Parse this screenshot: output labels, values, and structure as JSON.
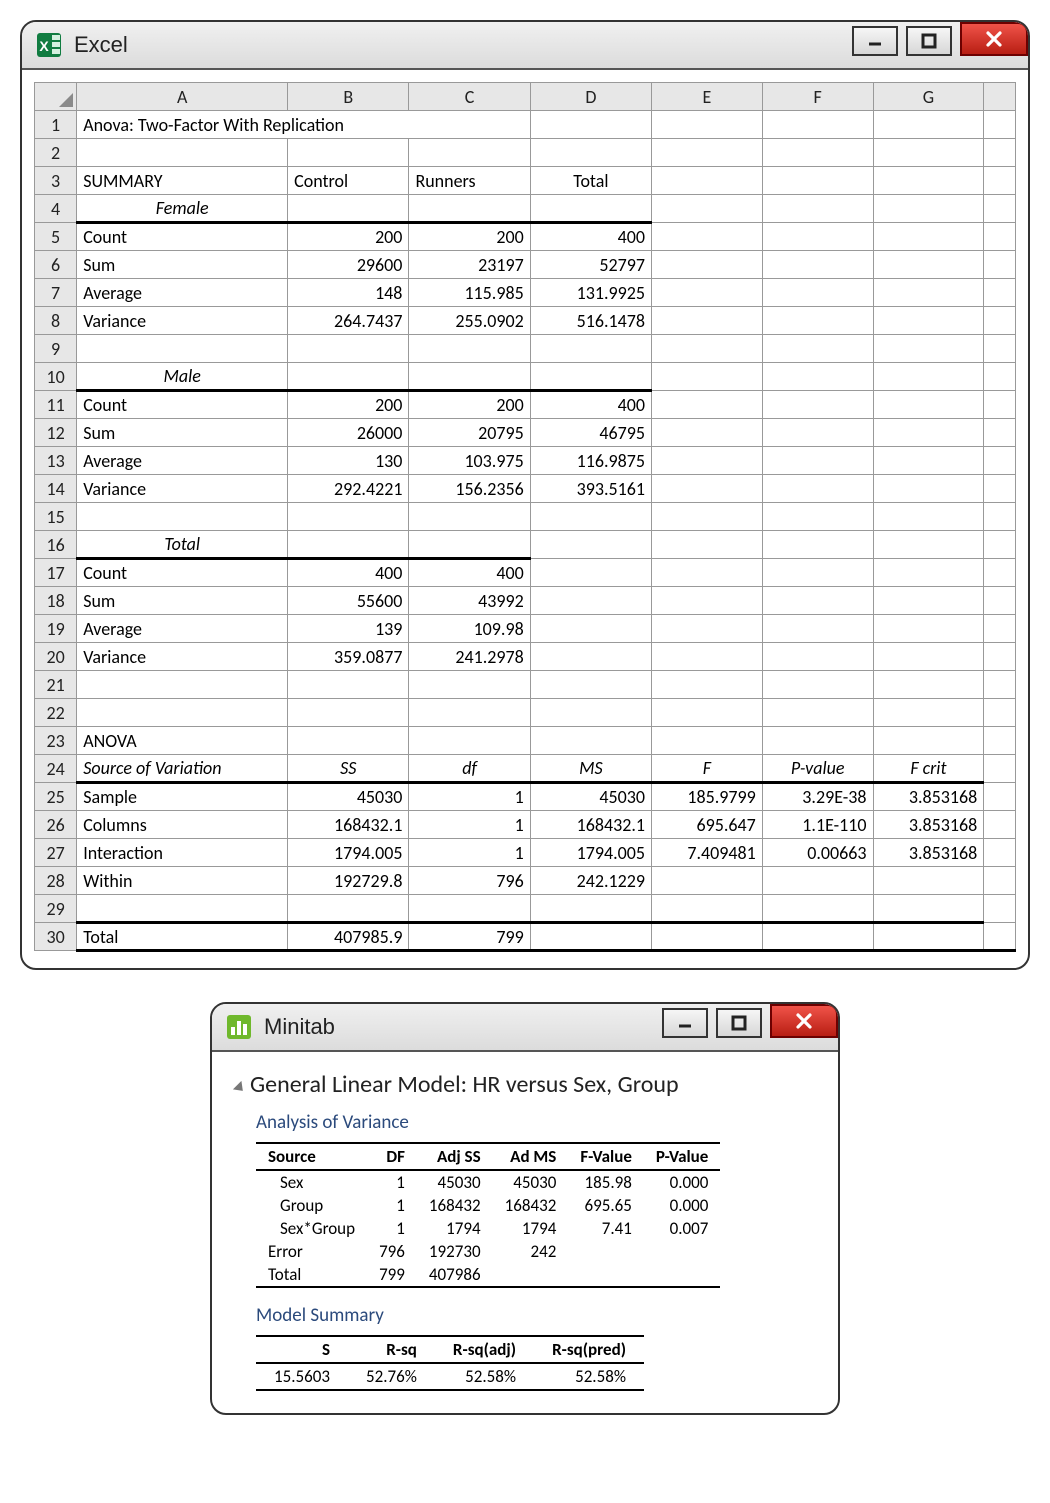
{
  "excel": {
    "app_name": "Excel",
    "columns": [
      "A",
      "B",
      "C",
      "D",
      "E",
      "F",
      "G"
    ],
    "row_numbers": [
      1,
      2,
      3,
      4,
      5,
      6,
      7,
      8,
      9,
      10,
      11,
      12,
      13,
      14,
      15,
      16,
      17,
      18,
      19,
      20,
      21,
      22,
      23,
      24,
      25,
      26,
      27,
      28,
      29,
      30
    ],
    "r1_title": "Anova: Two-Factor With Replication",
    "r3": {
      "A": "SUMMARY",
      "B": "Control",
      "C": "Runners",
      "D": "Total"
    },
    "r4_A": "Female",
    "r5": {
      "A": "Count",
      "B": "200",
      "C": "200",
      "D": "400"
    },
    "r6": {
      "A": "Sum",
      "B": "29600",
      "C": "23197",
      "D": "52797"
    },
    "r7": {
      "A": "Average",
      "B": "148",
      "C": "115.985",
      "D": "131.9925"
    },
    "r8": {
      "A": "Variance",
      "B": "264.7437",
      "C": "255.0902",
      "D": "516.1478"
    },
    "r10_A": "Male",
    "r11": {
      "A": "Count",
      "B": "200",
      "C": "200",
      "D": "400"
    },
    "r12": {
      "A": "Sum",
      "B": "26000",
      "C": "20795",
      "D": "46795"
    },
    "r13": {
      "A": "Average",
      "B": "130",
      "C": "103.975",
      "D": "116.9875"
    },
    "r14": {
      "A": "Variance",
      "B": "292.4221",
      "C": "156.2356",
      "D": "393.5161"
    },
    "r16_A": "Total",
    "r17": {
      "A": "Count",
      "B": "400",
      "C": "400"
    },
    "r18": {
      "A": "Sum",
      "B": "55600",
      "C": "43992"
    },
    "r19": {
      "A": "Average",
      "B": "139",
      "C": "109.98"
    },
    "r20": {
      "A": "Variance",
      "B": "359.0877",
      "C": "241.2978"
    },
    "r23_A": "ANOVA",
    "r24": {
      "A": "Source of Variation",
      "B": "SS",
      "C": "df",
      "D": "MS",
      "E": "F",
      "F": "P-value",
      "G": "F crit"
    },
    "r25": {
      "A": "Sample",
      "B": "45030",
      "C": "1",
      "D": "45030",
      "E": "185.9799",
      "F": "3.29E-38",
      "G": "3.853168"
    },
    "r26": {
      "A": "Columns",
      "B": "168432.1",
      "C": "1",
      "D": "168432.1",
      "E": "695.647",
      "F": "1.1E-110",
      "G": "3.853168"
    },
    "r27": {
      "A": "Interaction",
      "B": "1794.005",
      "C": "1",
      "D": "1794.005",
      "E": "7.409481",
      "F": "0.00663",
      "G": "3.853168"
    },
    "r28": {
      "A": "Within",
      "B": "192729.8",
      "C": "796",
      "D": "242.1229"
    },
    "r30": {
      "A": "Total",
      "B": "407985.9",
      "C": "799"
    }
  },
  "minitab": {
    "app_name": "Minitab",
    "title": "General Linear Model: HR versus Sex, Group",
    "aov_heading": "Analysis of Variance",
    "aov_headers": {
      "source": "Source",
      "df": "DF",
      "adjss": "Adj SS",
      "adms": "Ad MS",
      "f": "F-Value",
      "p": "P-Value"
    },
    "aov_rows": [
      {
        "source": "Sex",
        "indent": true,
        "df": "1",
        "adjss": "45030",
        "adms": "45030",
        "f": "185.98",
        "p": "0.000"
      },
      {
        "source": "Group",
        "indent": true,
        "df": "1",
        "adjss": "168432",
        "adms": "168432",
        "f": "695.65",
        "p": "0.000"
      },
      {
        "source": "Sex*Group",
        "indent": true,
        "df": "1",
        "adjss": "1794",
        "adms": "1794",
        "f": "7.41",
        "p": "0.007"
      },
      {
        "source": "Error",
        "indent": false,
        "df": "796",
        "adjss": "192730",
        "adms": "242",
        "f": "",
        "p": ""
      },
      {
        "source": "Total",
        "indent": false,
        "df": "799",
        "adjss": "407986",
        "adms": "",
        "f": "",
        "p": ""
      }
    ],
    "ms_heading": "Model Summary",
    "ms_headers": {
      "s": "S",
      "rsq": "R-sq",
      "rsqa": "R-sq(adj)",
      "rsqp": "R-sq(pred)"
    },
    "ms_row": {
      "s": "15.5603",
      "rsq": "52.76%",
      "rsqa": "52.58%",
      "rsqp": "52.58%"
    }
  },
  "chart_data": [
    {
      "type": "table",
      "title": "Anova: Two-Factor With Replication — SUMMARY (Female)",
      "columns": [
        "",
        "Control",
        "Runners",
        "Total"
      ],
      "rows": [
        [
          "Count",
          200,
          200,
          400
        ],
        [
          "Sum",
          29600,
          23197,
          52797
        ],
        [
          "Average",
          148,
          115.985,
          131.9925
        ],
        [
          "Variance",
          264.7437,
          255.0902,
          516.1478
        ]
      ]
    },
    {
      "type": "table",
      "title": "Anova: Two-Factor With Replication — SUMMARY (Male)",
      "columns": [
        "",
        "Control",
        "Runners",
        "Total"
      ],
      "rows": [
        [
          "Count",
          200,
          200,
          400
        ],
        [
          "Sum",
          26000,
          20795,
          46795
        ],
        [
          "Average",
          130,
          103.975,
          116.9875
        ],
        [
          "Variance",
          292.4221,
          156.2356,
          393.5161
        ]
      ]
    },
    {
      "type": "table",
      "title": "Anova: Two-Factor With Replication — SUMMARY (Total)",
      "columns": [
        "",
        "Control",
        "Runners"
      ],
      "rows": [
        [
          "Count",
          400,
          400
        ],
        [
          "Sum",
          55600,
          43992
        ],
        [
          "Average",
          139,
          109.98
        ],
        [
          "Variance",
          359.0877,
          241.2978
        ]
      ]
    },
    {
      "type": "table",
      "title": "ANOVA",
      "columns": [
        "Source of Variation",
        "SS",
        "df",
        "MS",
        "F",
        "P-value",
        "F crit"
      ],
      "rows": [
        [
          "Sample",
          45030,
          1,
          45030,
          185.9799,
          "3.29E-38",
          3.853168
        ],
        [
          "Columns",
          168432.1,
          1,
          168432.1,
          695.647,
          "1.1E-110",
          3.853168
        ],
        [
          "Interaction",
          1794.005,
          1,
          1794.005,
          7.409481,
          0.00663,
          3.853168
        ],
        [
          "Within",
          192729.8,
          796,
          242.1229,
          null,
          null,
          null
        ],
        [
          "Total",
          407985.9,
          799,
          null,
          null,
          null,
          null
        ]
      ]
    },
    {
      "type": "table",
      "title": "Minitab — Analysis of Variance",
      "columns": [
        "Source",
        "DF",
        "Adj SS",
        "Ad MS",
        "F-Value",
        "P-Value"
      ],
      "rows": [
        [
          "Sex",
          1,
          45030,
          45030,
          185.98,
          0.0
        ],
        [
          "Group",
          1,
          168432,
          168432,
          695.65,
          0.0
        ],
        [
          "Sex*Group",
          1,
          1794,
          1794,
          7.41,
          0.007
        ],
        [
          "Error",
          796,
          192730,
          242,
          null,
          null
        ],
        [
          "Total",
          799,
          407986,
          null,
          null,
          null
        ]
      ]
    },
    {
      "type": "table",
      "title": "Minitab — Model Summary",
      "columns": [
        "S",
        "R-sq",
        "R-sq(adj)",
        "R-sq(pred)"
      ],
      "rows": [
        [
          15.5603,
          "52.76%",
          "52.58%",
          "52.58%"
        ]
      ]
    }
  ]
}
